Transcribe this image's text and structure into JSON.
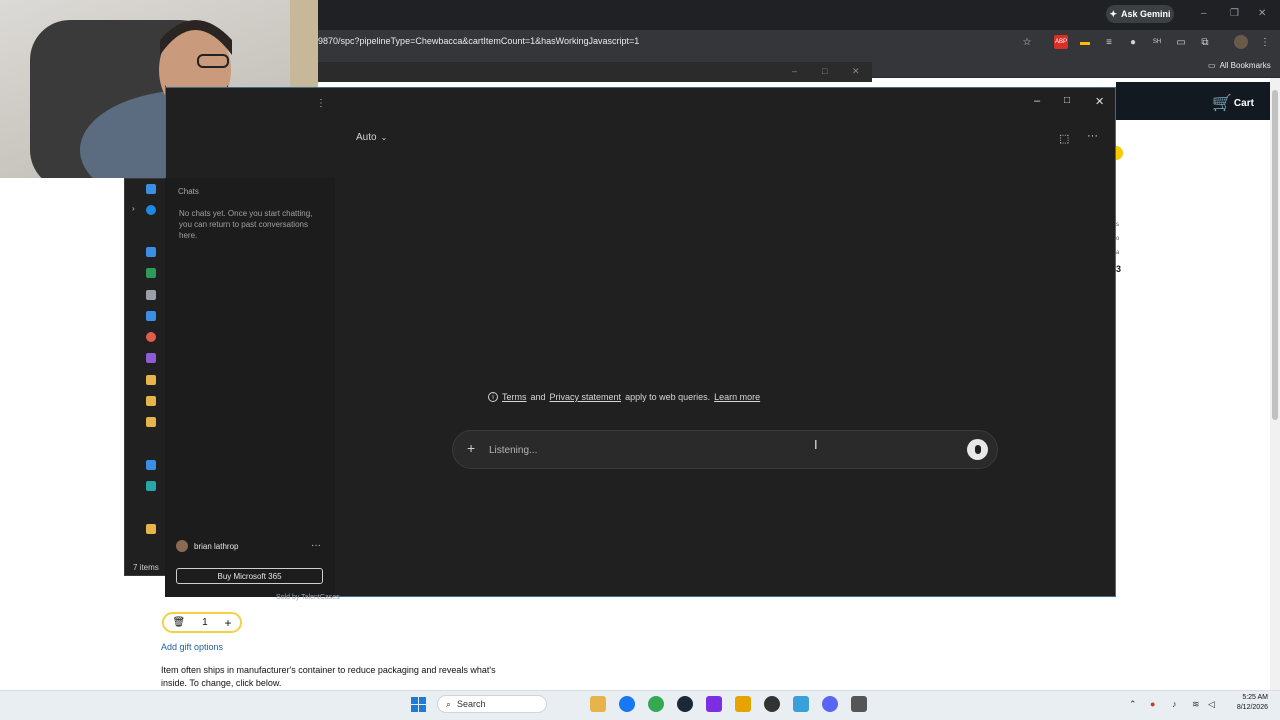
{
  "browser": {
    "url": "9870/spc?pipelineType=Chewbacca&cartItemCount=1&hasWorkingJavascript=1",
    "ask_gemini": "Ask Gemini",
    "all_bookmarks": "All Bookmarks",
    "cart_label": "Cart"
  },
  "explorer": {
    "status": "7 items"
  },
  "copilot": {
    "mode": "Auto",
    "sidebar": {
      "chats_heading": "Chats",
      "empty_message": "No chats yet. Once you start chatting, you can return to past conversations here."
    },
    "user_name": "brian lathrop",
    "buy_button": "Buy Microsoft 365",
    "terms": {
      "terms_link": "Terms",
      "and": "and",
      "privacy_link": "Privacy statement",
      "suffix": "apply to web queries.",
      "learn_more": "Learn more"
    },
    "composer": {
      "placeholder": "Listening..."
    }
  },
  "cart_page": {
    "sold_by": "Sold by TalentCases",
    "quantity": "1",
    "gift_options": "Add gift options",
    "ships_note": "Item often ships in manufacturer's container to reduce packaging and reveals what's inside. To change, click below."
  },
  "taskbar": {
    "search": "Search",
    "time": "5:25 AM",
    "date": "8/12/2026"
  },
  "colors": {
    "copilot_bg": "#202020",
    "copilot_border": "#3d6e8a",
    "amazon_header": "#131921",
    "quantity_border": "#f3d046",
    "link_blue": "#2162a1"
  }
}
